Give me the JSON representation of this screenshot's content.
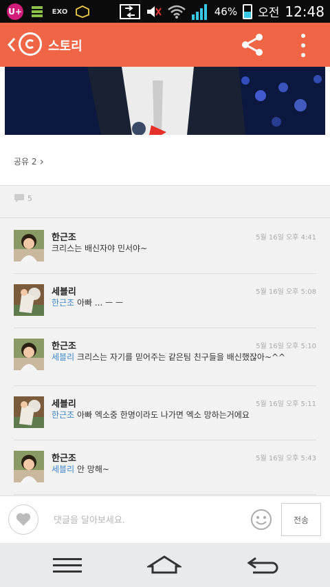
{
  "status_bar": {
    "carrier": "U+",
    "exo_badge": "EXO",
    "battery_percent": "46%",
    "ampm": "오전",
    "time": "12:48",
    "battery_level": 0.46
  },
  "app_bar": {
    "title": "스토리"
  },
  "post": {
    "share_label": "공유 2"
  },
  "comment_count": "5",
  "comments": [
    {
      "name": "한근조",
      "date": "5월 16일 오후 4:41",
      "mention": "",
      "text": "크리스는 배신자야 민서야~"
    },
    {
      "name": "세블리",
      "date": "5월 16일 오후 5:08",
      "mention": "한근조",
      "text": "아빠 ... ㅡ ㅡ"
    },
    {
      "name": "한근조",
      "date": "5월 16일 오후 5:10",
      "mention": "세블리",
      "text": "크리스는 자기를 믿어주는 같은팀 친구들을 배신했잖아~^^"
    },
    {
      "name": "세블리",
      "date": "5월 16일 오후 5:11",
      "mention": "한근조",
      "text": "아빠 엑소중 한명이라도 나가면 엑소 망하는거에요"
    },
    {
      "name": "한근조",
      "date": "5월 16일 오후 5:43",
      "mention": "세블리",
      "text": "안 망해~"
    }
  ],
  "input": {
    "placeholder": "댓글을 달아보세요.",
    "send_label": "전송"
  },
  "colors": {
    "accent": "#ef6546",
    "mention": "#3f86c6"
  }
}
